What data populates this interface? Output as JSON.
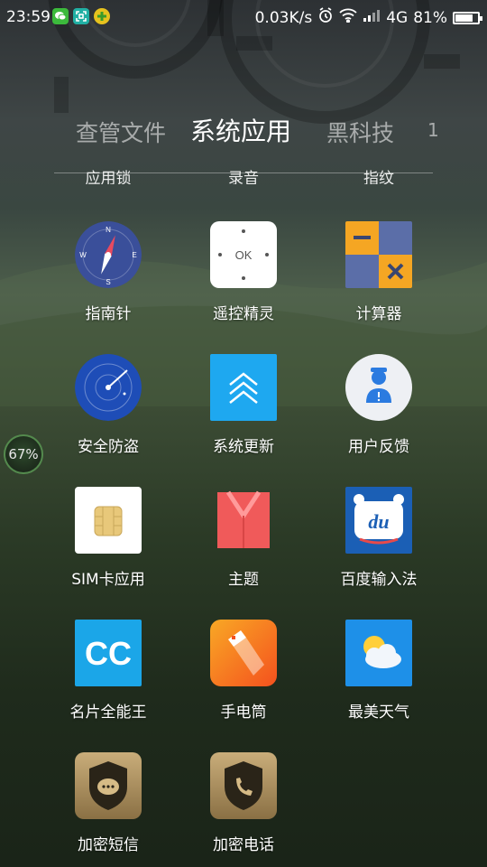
{
  "status_bar": {
    "time": "23:59",
    "network_speed": "0.03K/s",
    "network_type": "4G",
    "battery_percent": "81%",
    "battery_level": 0.81,
    "notification_icons": [
      "wechat-icon",
      "scan-icon",
      "plus-app-icon"
    ],
    "system_icons": [
      "alarm-icon",
      "wifi-icon",
      "signal-icon"
    ]
  },
  "tabs": [
    {
      "label": "查管文件"
    },
    {
      "label": "系统应用"
    },
    {
      "label": "黑科技"
    },
    {
      "label": "1"
    }
  ],
  "active_tab": "系统应用",
  "clipped_row": [
    "应用锁",
    "录音",
    "指纹"
  ],
  "apps": [
    {
      "label": "指南针",
      "icon": "compass-icon",
      "color": "#3a4f9a"
    },
    {
      "label": "遥控精灵",
      "icon": "remote-control-icon",
      "color": "#ffffff"
    },
    {
      "label": "计算器",
      "icon": "calculator-icon",
      "color": "#f5a623"
    },
    {
      "label": "安全防盗",
      "icon": "radar-icon",
      "color": "#1e4db7"
    },
    {
      "label": "系统更新",
      "icon": "system-update-icon",
      "color": "#1ea8f0"
    },
    {
      "label": "用户反馈",
      "icon": "feedback-icon",
      "color": "#2b7be0"
    },
    {
      "label": "SIM卡应用",
      "icon": "sim-card-icon",
      "color": "#e8c87a"
    },
    {
      "label": "主题",
      "icon": "theme-icon",
      "color": "#f05a5a"
    },
    {
      "label": "百度输入法",
      "icon": "baidu-input-icon",
      "color": "#1b5fb5"
    },
    {
      "label": "名片全能王",
      "icon": "camcard-icon",
      "color": "#1ba6e8"
    },
    {
      "label": "手电筒",
      "icon": "flashlight-icon",
      "color": "#f57c1f"
    },
    {
      "label": "最美天气",
      "icon": "weather-icon",
      "color": "#1e90e8"
    },
    {
      "label": "加密短信",
      "icon": "secure-sms-icon",
      "color": "#b89a64"
    },
    {
      "label": "加密电话",
      "icon": "secure-call-icon",
      "color": "#b89a64"
    }
  ],
  "float_ball": {
    "text": "67%"
  },
  "remote": {
    "ok": "OK"
  },
  "compass": {
    "n": "N",
    "s": "S",
    "e": "E",
    "w": "W"
  },
  "baidu": {
    "text": "du"
  },
  "camcard": {
    "text": "CC"
  }
}
